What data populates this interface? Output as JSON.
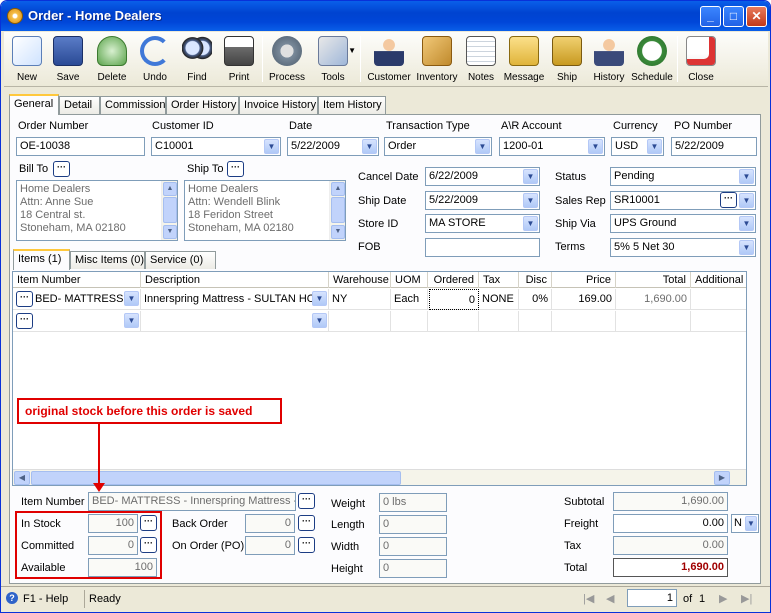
{
  "window": {
    "title": "Order - Home Dealers"
  },
  "toolbar": [
    {
      "label": "New",
      "icon": "new-icon"
    },
    {
      "label": "Save",
      "icon": "save-icon"
    },
    {
      "label": "Delete",
      "icon": "delete-icon"
    },
    {
      "label": "Undo",
      "icon": "undo-icon"
    },
    {
      "label": "Find",
      "icon": "find-icon"
    },
    {
      "label": "Print",
      "icon": "print-icon"
    },
    {
      "label": "Process",
      "icon": "process-icon"
    },
    {
      "label": "Tools",
      "icon": "tools-icon"
    },
    {
      "label": "Customer",
      "icon": "customer-icon"
    },
    {
      "label": "Inventory",
      "icon": "inventory-icon"
    },
    {
      "label": "Notes",
      "icon": "notes-icon"
    },
    {
      "label": "Message",
      "icon": "message-icon"
    },
    {
      "label": "Ship",
      "icon": "ship-icon"
    },
    {
      "label": "History",
      "icon": "history-icon"
    },
    {
      "label": "Schedule",
      "icon": "schedule-icon"
    },
    {
      "label": "Close",
      "icon": "close-icon"
    }
  ],
  "tabs": [
    "General",
    "Detail",
    "Commission",
    "Order History",
    "Invoice History",
    "Item History"
  ],
  "header": {
    "order_number_label": "Order Number",
    "order_number": "OE-10038",
    "customer_id_label": "Customer ID",
    "customer_id": "C10001",
    "date_label": "Date",
    "date": "5/22/2009",
    "transaction_type_label": "Transaction Type",
    "transaction_type": "Order",
    "ar_account_label": "A\\R Account",
    "ar_account": "1200-01",
    "currency_label": "Currency",
    "currency": "USD",
    "po_number_label": "PO Number",
    "po_number": "5/22/2009"
  },
  "bill_to": {
    "label": "Bill To",
    "lines": [
      "Home Dealers",
      "Attn: Anne Sue",
      "18 Central st.",
      "Stoneham, MA 02180"
    ]
  },
  "ship_to": {
    "label": "Ship To",
    "lines": [
      "Home Dealers",
      "Attn: Wendell Blink",
      "18 Feridon Street",
      "Stoneham, MA 02180"
    ]
  },
  "details": {
    "cancel_date_label": "Cancel  Date",
    "cancel_date": "6/22/2009",
    "ship_date_label": "Ship Date",
    "ship_date": "5/22/2009",
    "store_id_label": "Store ID",
    "store_id": "MA STORE",
    "fob_label": "FOB",
    "fob": "",
    "status_label": "Status",
    "status": "Pending",
    "sales_rep_label": "Sales Rep",
    "sales_rep": "SR10001",
    "ship_via_label": "Ship Via",
    "ship_via": "UPS Ground",
    "terms_label": "Terms",
    "terms": "5% 5 Net 30"
  },
  "item_tabs": [
    "Items (1)",
    "Misc Items (0)",
    "Service (0)"
  ],
  "grid": {
    "columns": [
      "Item Number",
      "Description",
      "Warehouse",
      "UOM",
      "Ordered",
      "Tax",
      "Disc",
      "Price",
      "Total",
      "Additional"
    ],
    "rows": [
      {
        "item": "BED- MATTRESS",
        "description": "Innerspring Mattress - SULTAN HO",
        "warehouse": "NY",
        "uom": "Each",
        "ordered": "0",
        "tax": "NONE",
        "disc": "0%",
        "price": "169.00",
        "total": "1,690.00",
        "additional": ""
      }
    ]
  },
  "annotation": "original stock before this order is saved",
  "item_info": {
    "item_number_label": "Item Number",
    "item_number": "BED- MATTRESS - Innerspring Mattress - S",
    "in_stock_label": "In Stock",
    "in_stock": "100",
    "committed_label": "Committed",
    "committed": "0",
    "available_label": "Available",
    "available": "100",
    "back_order_label": "Back Order",
    "back_order": "0",
    "on_order_label": "On Order (PO)",
    "on_order": "0",
    "weight_label": "Weight",
    "weight": "0 lbs",
    "length_label": "Length",
    "length": "0",
    "width_label": "Width",
    "width": "0",
    "height_label": "Height",
    "height": "0"
  },
  "totals": {
    "subtotal_label": "Subtotal",
    "subtotal": "1,690.00",
    "freight_label": "Freight",
    "freight": "0.00",
    "freight_code": "N",
    "tax_label": "Tax",
    "tax": "0.00",
    "total_label": "Total",
    "total": "1,690.00"
  },
  "status_bar": {
    "help": "F1 - Help",
    "state": "Ready",
    "page": "1",
    "of_label": "of",
    "pages": "1"
  }
}
